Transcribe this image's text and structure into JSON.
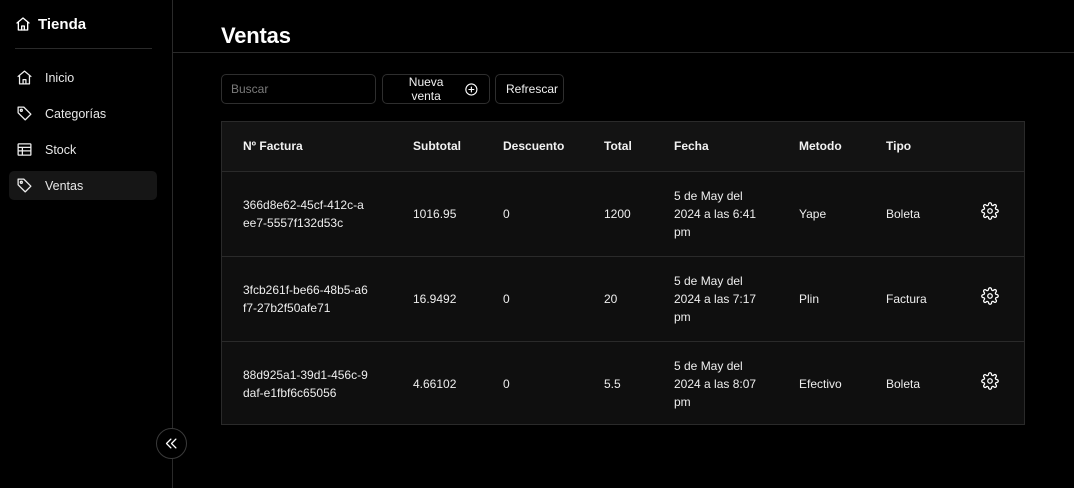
{
  "sidebar": {
    "brand": "Tienda",
    "items": [
      {
        "label": "Inicio",
        "icon": "home-icon"
      },
      {
        "label": "Categorías",
        "icon": "tag-icon"
      },
      {
        "label": "Stock",
        "icon": "table-icon"
      },
      {
        "label": "Ventas",
        "icon": "tag-icon",
        "active": true
      }
    ],
    "collapse_icon": "chevrons-left-icon"
  },
  "header": {
    "title": "Ventas"
  },
  "toolbar": {
    "search_placeholder": "Buscar",
    "new_label": "Nueva venta",
    "refresh_label": "Refrescar"
  },
  "table": {
    "columns": [
      "Nº Factura",
      "Subtotal",
      "Descuento",
      "Total",
      "Fecha",
      "Metodo",
      "Tipo",
      ""
    ],
    "rows": [
      {
        "factura": "366d8e62-45cf-412c-aee7-5557f132d53c",
        "subtotal": "1016.95",
        "descuento": "0",
        "total": "1200",
        "fecha": "5 de May del 2024 a las 6:41 pm",
        "metodo": "Yape",
        "tipo": "Boleta"
      },
      {
        "factura": "3fcb261f-be66-48b5-a6f7-27b2f50afe71",
        "subtotal": "16.9492",
        "descuento": "0",
        "total": "20",
        "fecha": "5 de May del 2024 a las 7:17 pm",
        "metodo": "Plin",
        "tipo": "Factura"
      },
      {
        "factura": "88d925a1-39d1-456c-9daf-e1fbf6c65056",
        "subtotal": "4.66102",
        "descuento": "0",
        "total": "5.5",
        "fecha": "5 de May del 2024 a las 8:07 pm",
        "metodo": "Efectivo",
        "tipo": "Boleta"
      }
    ]
  },
  "colors": {
    "background": "#000000",
    "panel": "#0f0f0f",
    "border": "#2a2a2a",
    "active_nav": "#161616"
  }
}
